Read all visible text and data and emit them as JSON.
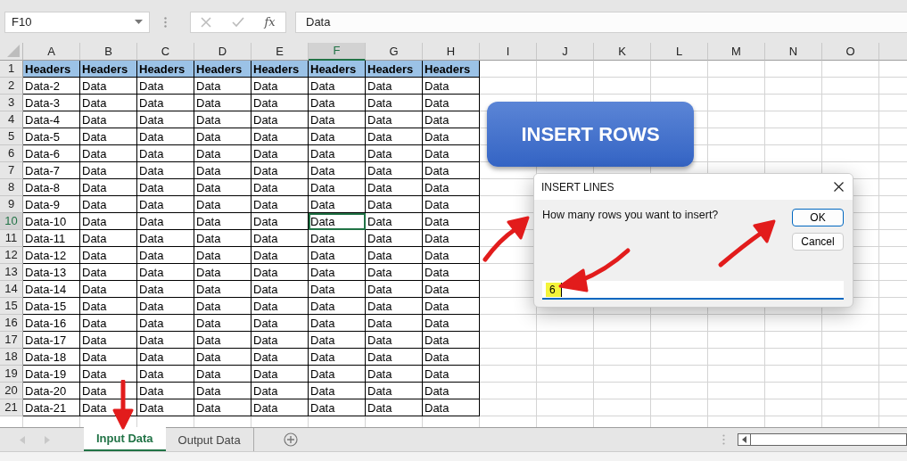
{
  "name_box": {
    "value": "F10"
  },
  "formula_bar": {
    "function_label": "fx",
    "value": "Data"
  },
  "columns": [
    {
      "label": "A",
      "selected": false
    },
    {
      "label": "B",
      "selected": false
    },
    {
      "label": "C",
      "selected": false
    },
    {
      "label": "D",
      "selected": false
    },
    {
      "label": "E",
      "selected": false
    },
    {
      "label": "F",
      "selected": true
    },
    {
      "label": "G",
      "selected": false
    },
    {
      "label": "H",
      "selected": false
    },
    {
      "label": "I",
      "selected": false
    },
    {
      "label": "J",
      "selected": false
    },
    {
      "label": "K",
      "selected": false
    },
    {
      "label": "L",
      "selected": false
    },
    {
      "label": "M",
      "selected": false
    },
    {
      "label": "N",
      "selected": false
    },
    {
      "label": "O",
      "selected": false
    }
  ],
  "rows": [
    {
      "number": "1",
      "kind": "header",
      "selected": false,
      "cells": [
        "Headers",
        "Headers",
        "Headers",
        "Headers",
        "Headers",
        "Headers",
        "Headers",
        "Headers"
      ]
    },
    {
      "number": "2",
      "kind": "data",
      "selected": false,
      "cells": [
        "Data-2",
        "Data",
        "Data",
        "Data",
        "Data",
        "Data",
        "Data",
        "Data"
      ]
    },
    {
      "number": "3",
      "kind": "data",
      "selected": false,
      "cells": [
        "Data-3",
        "Data",
        "Data",
        "Data",
        "Data",
        "Data",
        "Data",
        "Data"
      ]
    },
    {
      "number": "4",
      "kind": "data",
      "selected": false,
      "cells": [
        "Data-4",
        "Data",
        "Data",
        "Data",
        "Data",
        "Data",
        "Data",
        "Data"
      ]
    },
    {
      "number": "5",
      "kind": "data",
      "selected": false,
      "cells": [
        "Data-5",
        "Data",
        "Data",
        "Data",
        "Data",
        "Data",
        "Data",
        "Data"
      ]
    },
    {
      "number": "6",
      "kind": "data",
      "selected": false,
      "cells": [
        "Data-6",
        "Data",
        "Data",
        "Data",
        "Data",
        "Data",
        "Data",
        "Data"
      ]
    },
    {
      "number": "7",
      "kind": "data",
      "selected": false,
      "cells": [
        "Data-7",
        "Data",
        "Data",
        "Data",
        "Data",
        "Data",
        "Data",
        "Data"
      ]
    },
    {
      "number": "8",
      "kind": "data",
      "selected": false,
      "cells": [
        "Data-8",
        "Data",
        "Data",
        "Data",
        "Data",
        "Data",
        "Data",
        "Data"
      ]
    },
    {
      "number": "9",
      "kind": "data",
      "selected": false,
      "cells": [
        "Data-9",
        "Data",
        "Data",
        "Data",
        "Data",
        "Data",
        "Data",
        "Data"
      ]
    },
    {
      "number": "10",
      "kind": "data",
      "selected": true,
      "cells": [
        "Data-10",
        "Data",
        "Data",
        "Data",
        "Data",
        "Data",
        "Data",
        "Data"
      ]
    },
    {
      "number": "11",
      "kind": "data",
      "selected": false,
      "cells": [
        "Data-11",
        "Data",
        "Data",
        "Data",
        "Data",
        "Data",
        "Data",
        "Data"
      ]
    },
    {
      "number": "12",
      "kind": "data",
      "selected": false,
      "cells": [
        "Data-12",
        "Data",
        "Data",
        "Data",
        "Data",
        "Data",
        "Data",
        "Data"
      ]
    },
    {
      "number": "13",
      "kind": "data",
      "selected": false,
      "cells": [
        "Data-13",
        "Data",
        "Data",
        "Data",
        "Data",
        "Data",
        "Data",
        "Data"
      ]
    },
    {
      "number": "14",
      "kind": "data",
      "selected": false,
      "cells": [
        "Data-14",
        "Data",
        "Data",
        "Data",
        "Data",
        "Data",
        "Data",
        "Data"
      ]
    },
    {
      "number": "15",
      "kind": "data",
      "selected": false,
      "cells": [
        "Data-15",
        "Data",
        "Data",
        "Data",
        "Data",
        "Data",
        "Data",
        "Data"
      ]
    },
    {
      "number": "16",
      "kind": "data",
      "selected": false,
      "cells": [
        "Data-16",
        "Data",
        "Data",
        "Data",
        "Data",
        "Data",
        "Data",
        "Data"
      ]
    },
    {
      "number": "17",
      "kind": "data",
      "selected": false,
      "cells": [
        "Data-17",
        "Data",
        "Data",
        "Data",
        "Data",
        "Data",
        "Data",
        "Data"
      ]
    },
    {
      "number": "18",
      "kind": "data",
      "selected": false,
      "cells": [
        "Data-18",
        "Data",
        "Data",
        "Data",
        "Data",
        "Data",
        "Data",
        "Data"
      ]
    },
    {
      "number": "19",
      "kind": "data",
      "selected": false,
      "cells": [
        "Data-19",
        "Data",
        "Data",
        "Data",
        "Data",
        "Data",
        "Data",
        "Data"
      ]
    },
    {
      "number": "20",
      "kind": "data",
      "selected": false,
      "cells": [
        "Data-20",
        "Data",
        "Data",
        "Data",
        "Data",
        "Data",
        "Data",
        "Data"
      ]
    },
    {
      "number": "21",
      "kind": "data",
      "selected": false,
      "cells": [
        "Data-21",
        "Data",
        "Data",
        "Data",
        "Data",
        "Data",
        "Data",
        "Data"
      ]
    }
  ],
  "macro_button": {
    "label": "INSERT ROWS"
  },
  "dialog": {
    "title": "INSERT LINES",
    "prompt": "How many rows you want to insert?",
    "input_value": "6",
    "buttons": [
      {
        "label": "OK",
        "default": true
      },
      {
        "label": "Cancel",
        "default": false
      }
    ]
  },
  "sheet_tabs": [
    {
      "label": "Input Data",
      "selected": true
    },
    {
      "label": "Output Data",
      "selected": false
    }
  ]
}
